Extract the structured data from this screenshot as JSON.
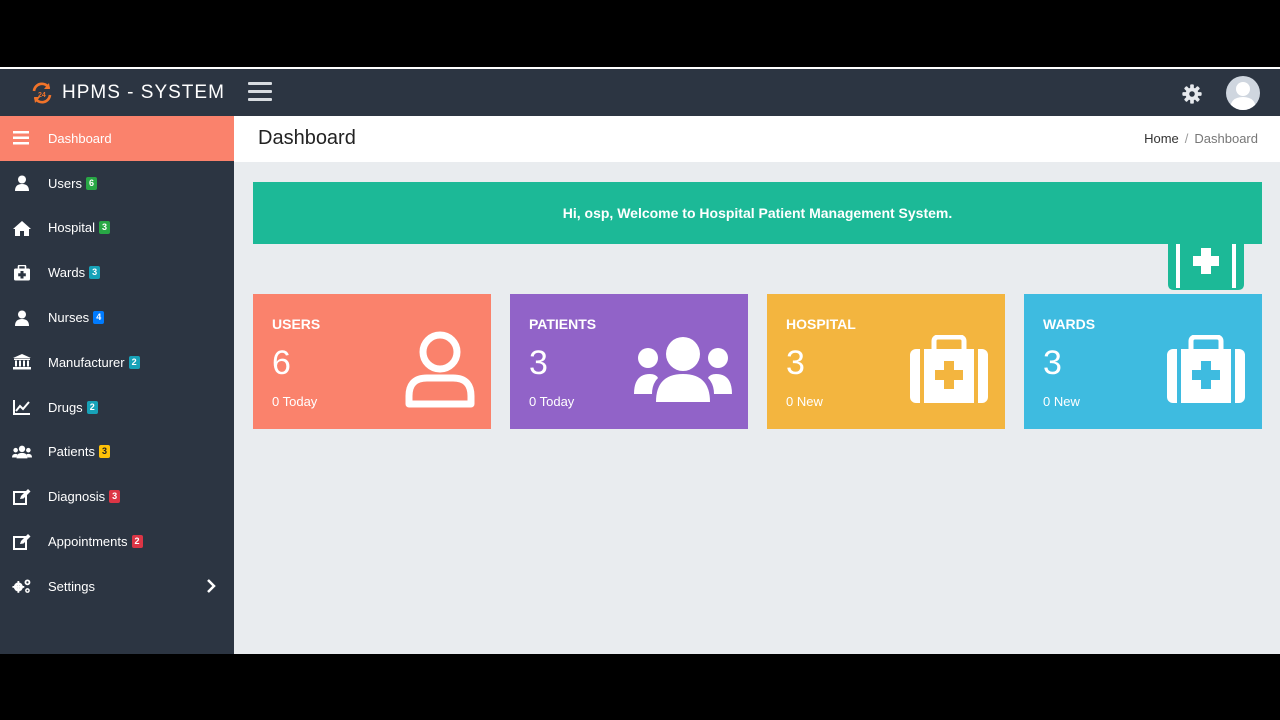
{
  "app": {
    "brand_title": "HPMS - SYSTEM",
    "logo_icon": "refresh-24-icon",
    "logo_color": "#f0732a"
  },
  "colors": {
    "nav_bg": "#2c3542",
    "active": "#fa826c",
    "welcome": "#1cb997",
    "users_card": "#fa826c",
    "patients_card": "#9163c8",
    "hospital_card": "#f3b53f",
    "wards_card": "#3ebbe0"
  },
  "sidebar": {
    "items": [
      {
        "label": "Dashboard",
        "icon": "bars-icon",
        "badge": ""
      },
      {
        "label": "Users",
        "icon": "user-icon",
        "badge": "6",
        "badge_color": "#28a745"
      },
      {
        "label": "Hospital",
        "icon": "home-icon",
        "badge": "3",
        "badge_color": "#28a745"
      },
      {
        "label": "Wards",
        "icon": "medkit-icon",
        "badge": "3",
        "badge_color": "#17a2b8"
      },
      {
        "label": "Nurses",
        "icon": "user-icon",
        "badge": "4",
        "badge_color": "#007bff"
      },
      {
        "label": "Manufacturer",
        "icon": "bank-icon",
        "badge": "2",
        "badge_color": "#17a2b8"
      },
      {
        "label": "Drugs",
        "icon": "line-chart-icon",
        "badge": "2",
        "badge_color": "#17a2b8"
      },
      {
        "label": "Patients",
        "icon": "users-icon",
        "badge": "3",
        "badge_color": "#ffc107"
      },
      {
        "label": "Diagnosis",
        "icon": "edit-icon",
        "badge": "3",
        "badge_color": "#dc3545"
      },
      {
        "label": "Appointments",
        "icon": "edit-icon",
        "badge": "2",
        "badge_color": "#dc3545"
      },
      {
        "label": "Settings",
        "icon": "cogs-icon",
        "badge": ""
      }
    ]
  },
  "header": {
    "page_title": "Dashboard",
    "breadcrumb_home": "Home",
    "breadcrumb_sep": "/",
    "breadcrumb_current": "Dashboard"
  },
  "welcome": {
    "message": "Hi, osp, Welcome to Hospital Patient Management System."
  },
  "cards": [
    {
      "title": "USERS",
      "value": "6",
      "sub": "0 Today",
      "icon": "user-outline-icon"
    },
    {
      "title": "PATIENTS",
      "value": "3",
      "sub": "0 Today",
      "icon": "users-icon"
    },
    {
      "title": "HOSPITAL",
      "value": "3",
      "sub": "0 New",
      "icon": "medkit-icon"
    },
    {
      "title": "WARDS",
      "value": "3",
      "sub": "0 New",
      "icon": "medkit-icon"
    }
  ]
}
